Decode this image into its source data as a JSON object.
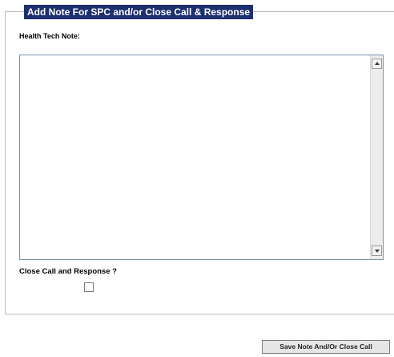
{
  "form": {
    "legend": "Add Note For SPC and/or Close Call & Response",
    "health_tech_note_label": "Health Tech Note:",
    "health_tech_note_value": "",
    "close_call_label": "Close Call and Response ?",
    "close_call_checked": false
  },
  "actions": {
    "save_label": "Save Note And/Or Close Call"
  },
  "colors": {
    "legend_background": "#1c2f6e",
    "legend_text": "#ffffff",
    "fieldset_border": "#b9b9b9",
    "textarea_border": "#7a8fa9"
  },
  "icons": {
    "scroll_up": "arrow-up-icon",
    "scroll_down": "arrow-down-icon"
  }
}
